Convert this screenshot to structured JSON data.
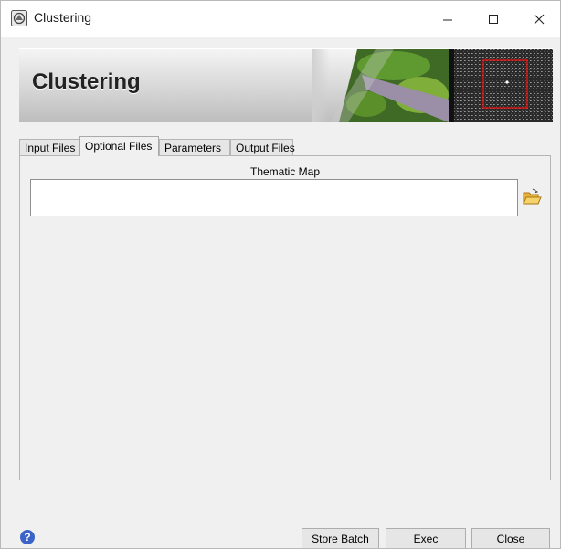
{
  "window": {
    "title": "Clustering",
    "controls": [
      "minimize-icon",
      "maximize-icon",
      "close-icon"
    ]
  },
  "banner": {
    "title": "Clustering"
  },
  "tabs": [
    {
      "label": "Input Files",
      "active": false
    },
    {
      "label": "Optional Files",
      "active": true
    },
    {
      "label": "Parameters",
      "active": false
    },
    {
      "label": "Output Files",
      "active": false
    }
  ],
  "optional_files": {
    "thematic_map_label": "Thematic Map",
    "thematic_map_value": "",
    "browse_icon": "folder-open-icon"
  },
  "footer": {
    "help_icon": "help-icon",
    "help_glyph": "?",
    "store_batch_label": "Store Batch",
    "exec_label": "Exec",
    "close_label": "Close"
  },
  "colors": {
    "window_bg": "#f0f0f0",
    "help_icon": "#3c64c8",
    "selection_box": "#e01010"
  }
}
